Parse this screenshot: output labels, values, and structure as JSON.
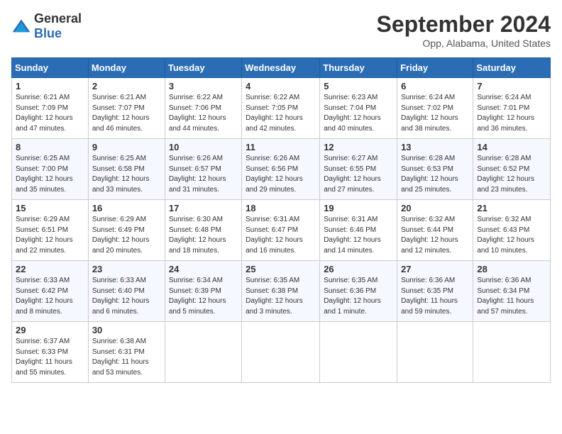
{
  "header": {
    "logo_general": "General",
    "logo_blue": "Blue",
    "month": "September 2024",
    "location": "Opp, Alabama, United States"
  },
  "days_of_week": [
    "Sunday",
    "Monday",
    "Tuesday",
    "Wednesday",
    "Thursday",
    "Friday",
    "Saturday"
  ],
  "weeks": [
    [
      {
        "num": "1",
        "info": "Sunrise: 6:21 AM\nSunset: 7:09 PM\nDaylight: 12 hours\nand 47 minutes."
      },
      {
        "num": "2",
        "info": "Sunrise: 6:21 AM\nSunset: 7:07 PM\nDaylight: 12 hours\nand 46 minutes."
      },
      {
        "num": "3",
        "info": "Sunrise: 6:22 AM\nSunset: 7:06 PM\nDaylight: 12 hours\nand 44 minutes."
      },
      {
        "num": "4",
        "info": "Sunrise: 6:22 AM\nSunset: 7:05 PM\nDaylight: 12 hours\nand 42 minutes."
      },
      {
        "num": "5",
        "info": "Sunrise: 6:23 AM\nSunset: 7:04 PM\nDaylight: 12 hours\nand 40 minutes."
      },
      {
        "num": "6",
        "info": "Sunrise: 6:24 AM\nSunset: 7:02 PM\nDaylight: 12 hours\nand 38 minutes."
      },
      {
        "num": "7",
        "info": "Sunrise: 6:24 AM\nSunset: 7:01 PM\nDaylight: 12 hours\nand 36 minutes."
      }
    ],
    [
      {
        "num": "8",
        "info": "Sunrise: 6:25 AM\nSunset: 7:00 PM\nDaylight: 12 hours\nand 35 minutes."
      },
      {
        "num": "9",
        "info": "Sunrise: 6:25 AM\nSunset: 6:58 PM\nDaylight: 12 hours\nand 33 minutes."
      },
      {
        "num": "10",
        "info": "Sunrise: 6:26 AM\nSunset: 6:57 PM\nDaylight: 12 hours\nand 31 minutes."
      },
      {
        "num": "11",
        "info": "Sunrise: 6:26 AM\nSunset: 6:56 PM\nDaylight: 12 hours\nand 29 minutes."
      },
      {
        "num": "12",
        "info": "Sunrise: 6:27 AM\nSunset: 6:55 PM\nDaylight: 12 hours\nand 27 minutes."
      },
      {
        "num": "13",
        "info": "Sunrise: 6:28 AM\nSunset: 6:53 PM\nDaylight: 12 hours\nand 25 minutes."
      },
      {
        "num": "14",
        "info": "Sunrise: 6:28 AM\nSunset: 6:52 PM\nDaylight: 12 hours\nand 23 minutes."
      }
    ],
    [
      {
        "num": "15",
        "info": "Sunrise: 6:29 AM\nSunset: 6:51 PM\nDaylight: 12 hours\nand 22 minutes."
      },
      {
        "num": "16",
        "info": "Sunrise: 6:29 AM\nSunset: 6:49 PM\nDaylight: 12 hours\nand 20 minutes."
      },
      {
        "num": "17",
        "info": "Sunrise: 6:30 AM\nSunset: 6:48 PM\nDaylight: 12 hours\nand 18 minutes."
      },
      {
        "num": "18",
        "info": "Sunrise: 6:31 AM\nSunset: 6:47 PM\nDaylight: 12 hours\nand 16 minutes."
      },
      {
        "num": "19",
        "info": "Sunrise: 6:31 AM\nSunset: 6:46 PM\nDaylight: 12 hours\nand 14 minutes."
      },
      {
        "num": "20",
        "info": "Sunrise: 6:32 AM\nSunset: 6:44 PM\nDaylight: 12 hours\nand 12 minutes."
      },
      {
        "num": "21",
        "info": "Sunrise: 6:32 AM\nSunset: 6:43 PM\nDaylight: 12 hours\nand 10 minutes."
      }
    ],
    [
      {
        "num": "22",
        "info": "Sunrise: 6:33 AM\nSunset: 6:42 PM\nDaylight: 12 hours\nand 8 minutes."
      },
      {
        "num": "23",
        "info": "Sunrise: 6:33 AM\nSunset: 6:40 PM\nDaylight: 12 hours\nand 6 minutes."
      },
      {
        "num": "24",
        "info": "Sunrise: 6:34 AM\nSunset: 6:39 PM\nDaylight: 12 hours\nand 5 minutes."
      },
      {
        "num": "25",
        "info": "Sunrise: 6:35 AM\nSunset: 6:38 PM\nDaylight: 12 hours\nand 3 minutes."
      },
      {
        "num": "26",
        "info": "Sunrise: 6:35 AM\nSunset: 6:36 PM\nDaylight: 12 hours\nand 1 minute."
      },
      {
        "num": "27",
        "info": "Sunrise: 6:36 AM\nSunset: 6:35 PM\nDaylight: 11 hours\nand 59 minutes."
      },
      {
        "num": "28",
        "info": "Sunrise: 6:36 AM\nSunset: 6:34 PM\nDaylight: 11 hours\nand 57 minutes."
      }
    ],
    [
      {
        "num": "29",
        "info": "Sunrise: 6:37 AM\nSunset: 6:33 PM\nDaylight: 11 hours\nand 55 minutes."
      },
      {
        "num": "30",
        "info": "Sunrise: 6:38 AM\nSunset: 6:31 PM\nDaylight: 11 hours\nand 53 minutes."
      },
      null,
      null,
      null,
      null,
      null
    ]
  ]
}
